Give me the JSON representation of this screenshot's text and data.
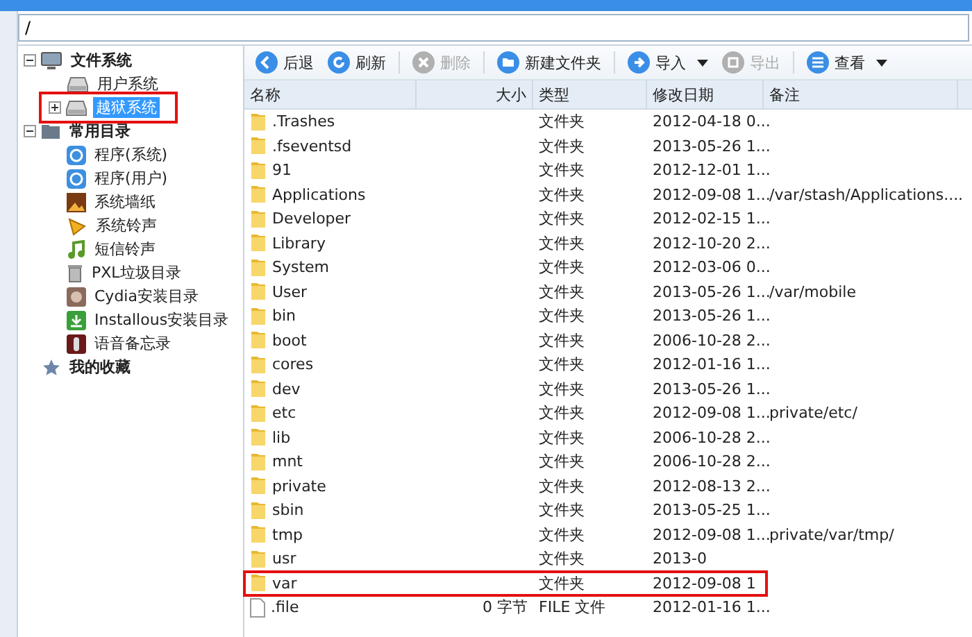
{
  "address_bar": {
    "value": "/"
  },
  "tree": [
    {
      "label": "文件系统",
      "expanded": true,
      "bold": true,
      "selected": false,
      "annotated": false,
      "children": [
        {
          "label": "用户系统",
          "selected": false,
          "annotated": false
        },
        {
          "label": "越狱系统",
          "selected": true,
          "annotated": true,
          "expanded": false
        }
      ]
    },
    {
      "label": "常用目录",
      "expanded": true,
      "bold": true,
      "selected": false,
      "annotated": false,
      "children": [
        {
          "label": "程序(系统)",
          "selected": false,
          "annotated": false
        },
        {
          "label": "程序(用户)",
          "selected": false,
          "annotated": false
        },
        {
          "label": "系统墙纸",
          "selected": false,
          "annotated": false
        },
        {
          "label": "系统铃声",
          "selected": false,
          "annotated": false
        },
        {
          "label": "短信铃声",
          "selected": false,
          "annotated": false
        },
        {
          "label": "PXL垃圾目录",
          "selected": false,
          "annotated": false
        },
        {
          "label": "Cydia安装目录",
          "selected": false,
          "annotated": false
        },
        {
          "label": "Installous安装目录",
          "selected": false,
          "annotated": false
        },
        {
          "label": "语音备忘录",
          "selected": false,
          "annotated": false
        }
      ]
    },
    {
      "label": "我的收藏",
      "bold": true,
      "selected": false,
      "annotated": false
    }
  ],
  "toolbar": [
    {
      "label": "后退",
      "disabled": false,
      "dropdown": false
    },
    {
      "label": "刷新",
      "disabled": false,
      "dropdown": false
    },
    {
      "label": "删除",
      "disabled": true,
      "dropdown": false
    },
    {
      "label": "新建文件夹",
      "disabled": false,
      "dropdown": false
    },
    {
      "label": "导入",
      "disabled": false,
      "dropdown": true
    },
    {
      "label": "导出",
      "disabled": true,
      "dropdown": false
    },
    {
      "label": "查看",
      "disabled": false,
      "dropdown": true
    }
  ],
  "table": {
    "columns": [
      "名称",
      "大小",
      "类型",
      "修改日期",
      "备注"
    ],
    "rows": [
      {
        "kind": "folder",
        "name": ".Trashes",
        "type": "文件夹",
        "date": "2012-04-18 0...",
        "annotated": false
      },
      {
        "kind": "folder",
        "name": ".fseventsd",
        "type": "文件夹",
        "date": "2013-05-26 1...",
        "annotated": false
      },
      {
        "kind": "folder",
        "name": "91",
        "type": "文件夹",
        "date": "2012-12-01 1...",
        "annotated": false
      },
      {
        "kind": "folder",
        "name": "Applications",
        "type": "文件夹",
        "date": "2012-09-08 1...",
        "note": "/var/stash/Applications....",
        "annotated": false
      },
      {
        "kind": "folder",
        "name": "Developer",
        "type": "文件夹",
        "date": "2012-02-15 1...",
        "annotated": false
      },
      {
        "kind": "folder",
        "name": "Library",
        "type": "文件夹",
        "date": "2012-10-20 2...",
        "annotated": false
      },
      {
        "kind": "folder",
        "name": "System",
        "type": "文件夹",
        "date": "2012-03-06 0...",
        "annotated": false
      },
      {
        "kind": "folder",
        "name": "User",
        "type": "文件夹",
        "date": "2013-05-26 1...",
        "note": "/var/mobile",
        "annotated": false
      },
      {
        "kind": "folder",
        "name": "bin",
        "type": "文件夹",
        "date": "2013-05-26 1...",
        "annotated": false
      },
      {
        "kind": "folder",
        "name": "boot",
        "type": "文件夹",
        "date": "2006-10-28 2...",
        "annotated": false
      },
      {
        "kind": "folder",
        "name": "cores",
        "type": "文件夹",
        "date": "2012-01-16 1...",
        "annotated": false
      },
      {
        "kind": "folder",
        "name": "dev",
        "type": "文件夹",
        "date": "2013-05-26 1...",
        "annotated": false
      },
      {
        "kind": "folder",
        "name": "etc",
        "type": "文件夹",
        "date": "2012-09-08 1...",
        "note": "private/etc/",
        "annotated": false
      },
      {
        "kind": "folder",
        "name": "lib",
        "type": "文件夹",
        "date": "2006-10-28 2...",
        "annotated": false
      },
      {
        "kind": "folder",
        "name": "mnt",
        "type": "文件夹",
        "date": "2006-10-28 2...",
        "annotated": false
      },
      {
        "kind": "folder",
        "name": "private",
        "type": "文件夹",
        "date": "2012-08-13 2...",
        "annotated": false
      },
      {
        "kind": "folder",
        "name": "sbin",
        "type": "文件夹",
        "date": "2013-05-25 1...",
        "annotated": false
      },
      {
        "kind": "folder",
        "name": "tmp",
        "type": "文件夹",
        "date": "2012-09-08 1...",
        "note": "private/var/tmp/",
        "annotated": false
      },
      {
        "kind": "folder",
        "name": "usr",
        "type": "文件夹",
        "date": "2013-0",
        "annotated": false
      },
      {
        "kind": "folder",
        "name": "var",
        "type": "文件夹",
        "date": "2012-09-08 1",
        "annotated": true
      },
      {
        "kind": "file",
        "name": ".file",
        "size": "0 字节",
        "type": "FILE 文件",
        "date": "2012-01-16 1...",
        "annotated": false
      }
    ]
  }
}
